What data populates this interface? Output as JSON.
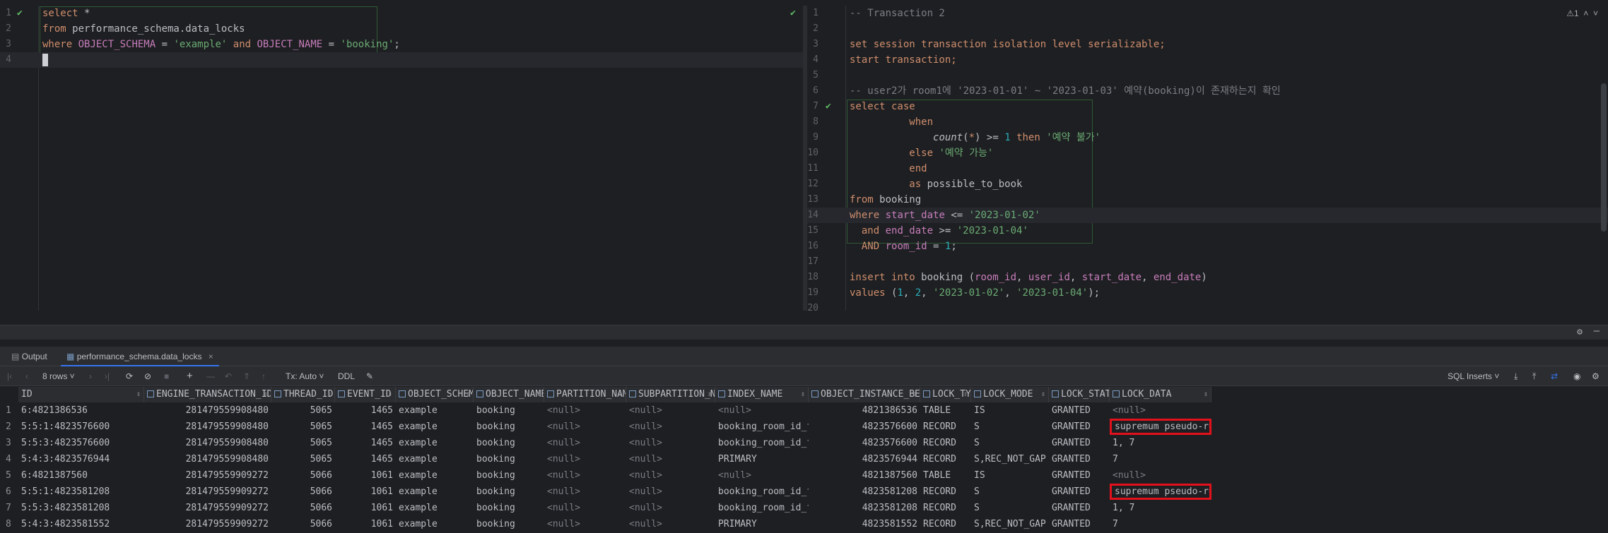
{
  "left_editor": {
    "lines": [
      {
        "n": "1",
        "html": "<span class=\"kw\">select</span> *"
      },
      {
        "n": "2",
        "html": "<span class=\"kw\">from</span> performance_schema.data_locks"
      },
      {
        "n": "3",
        "html": "<span class=\"kw\">where</span> <span class=\"fld\">OBJECT_SCHEMA</span> = <span class=\"str\">'example'</span> <span class=\"kw\">and</span> <span class=\"fld\">OBJECT_NAME</span> = <span class=\"str\">'booking'</span>;"
      },
      {
        "n": "4",
        "html": ""
      }
    ]
  },
  "right_editor": {
    "inspection": "⚠1",
    "lines": [
      {
        "n": "1",
        "html": "<span class=\"cmt\">-- Transaction 2</span>"
      },
      {
        "n": "2",
        "html": ""
      },
      {
        "n": "3",
        "html": "<span class=\"kw\">set session transaction isolation level serializable;</span>"
      },
      {
        "n": "4",
        "html": "<span class=\"kw\">start transaction;</span>"
      },
      {
        "n": "5",
        "html": ""
      },
      {
        "n": "6",
        "html": "<span class=\"cmt\">-- user2가 room1에 '2023-01-01' ~ '2023-01-03' 예약(booking)이 존재하는지 확인</span>"
      },
      {
        "n": "7",
        "html": "<span class=\"kw\">select case</span>"
      },
      {
        "n": "8",
        "html": "          <span class=\"kw\">when</span>"
      },
      {
        "n": "9",
        "html": "              <span class=\"fn\">count</span>(<span class=\"kw\">*</span>) >= <span class=\"num\">1</span> <span class=\"kw\">then</span> <span class=\"str\">'예약 불가'</span>"
      },
      {
        "n": "10",
        "html": "          <span class=\"kw\">else</span> <span class=\"str\">'예약 가능'</span>"
      },
      {
        "n": "11",
        "html": "          <span class=\"kw\">end</span>"
      },
      {
        "n": "12",
        "html": "          <span class=\"kw\">as</span> possible_to_book"
      },
      {
        "n": "13",
        "html": "<span class=\"kw\">from</span> booking"
      },
      {
        "n": "14",
        "html": "<span class=\"kw\">where</span> <span class=\"fld\">start_date</span> <= <span class=\"str\">'2023-01-02'</span>"
      },
      {
        "n": "15",
        "html": "  <span class=\"kw\">and</span> <span class=\"fld\">end_date</span> >= <span class=\"str\">'2023-01-04'</span>"
      },
      {
        "n": "16",
        "html": "  <span class=\"kw\">AND</span> <span class=\"fld\">room_id</span> = <span class=\"num\">1</span>;"
      },
      {
        "n": "17",
        "html": ""
      },
      {
        "n": "18",
        "html": "<span class=\"kw\">insert into</span> booking (<span class=\"fld\">room_id</span>, <span class=\"fld\">user_id</span>, <span class=\"fld\">start_date</span>, <span class=\"fld\">end_date</span>)"
      },
      {
        "n": "19",
        "html": "<span class=\"kw\">values</span> (<span class=\"num\">1</span>, <span class=\"num\">2</span>, <span class=\"str\">'2023-01-02'</span>, <span class=\"str\">'2023-01-04'</span>);"
      },
      {
        "n": "20",
        "html": ""
      }
    ]
  },
  "tabs": {
    "output": "Output",
    "result": "performance_schema.data_locks"
  },
  "toolbar": {
    "rows": "8 rows",
    "tx": "Tx: Auto",
    "ddl": "DDL",
    "export": "SQL Inserts"
  },
  "grid": {
    "columns": [
      "ID",
      "ENGINE_TRANSACTION_ID",
      "THREAD_ID",
      "EVENT_ID",
      "OBJECT_SCHEMA",
      "OBJECT_NAME",
      "PARTITION_NAME",
      "SUBPARTITION_NAME",
      "INDEX_NAME",
      "OBJECT_INSTANCE_BEGIN",
      "LOCK_TYPE",
      "LOCK_MODE",
      "LOCK_STATUS",
      "LOCK_DATA"
    ],
    "rows": [
      [
        "1",
        "6:4821386536",
        "281479559908480",
        "5065",
        "1465",
        "example",
        "booking",
        "<null>",
        "<null>",
        "<null>",
        "4821386536",
        "TABLE",
        "IS",
        "GRANTED",
        "<null>"
      ],
      [
        "2",
        "5:5:1:4823576600",
        "281479559908480",
        "5065",
        "1465",
        "example",
        "booking",
        "<null>",
        "<null>",
        "booking_room_id_fk",
        "4823576600",
        "RECORD",
        "S",
        "GRANTED",
        "supremum pseudo-record"
      ],
      [
        "3",
        "5:5:3:4823576600",
        "281479559908480",
        "5065",
        "1465",
        "example",
        "booking",
        "<null>",
        "<null>",
        "booking_room_id_fk",
        "4823576600",
        "RECORD",
        "S",
        "GRANTED",
        "1, 7"
      ],
      [
        "4",
        "5:4:3:4823576944",
        "281479559908480",
        "5065",
        "1465",
        "example",
        "booking",
        "<null>",
        "<null>",
        "PRIMARY",
        "4823576944",
        "RECORD",
        "S,REC_NOT_GAP",
        "GRANTED",
        "7"
      ],
      [
        "5",
        "6:4821387560",
        "281479559909272",
        "5066",
        "1061",
        "example",
        "booking",
        "<null>",
        "<null>",
        "<null>",
        "4821387560",
        "TABLE",
        "IS",
        "GRANTED",
        "<null>"
      ],
      [
        "6",
        "5:5:1:4823581208",
        "281479559909272",
        "5066",
        "1061",
        "example",
        "booking",
        "<null>",
        "<null>",
        "booking_room_id_fk",
        "4823581208",
        "RECORD",
        "S",
        "GRANTED",
        "supremum pseudo-record"
      ],
      [
        "7",
        "5:5:3:4823581208",
        "281479559909272",
        "5066",
        "1061",
        "example",
        "booking",
        "<null>",
        "<null>",
        "booking_room_id_fk",
        "4823581208",
        "RECORD",
        "S",
        "GRANTED",
        "1, 7"
      ],
      [
        "8",
        "5:4:3:4823581552",
        "281479559909272",
        "5066",
        "1061",
        "example",
        "booking",
        "<null>",
        "<null>",
        "PRIMARY",
        "4823581552",
        "RECORD",
        "S,REC_NOT_GAP",
        "GRANTED",
        "7"
      ]
    ],
    "highlighted_rows": [
      2,
      6
    ]
  }
}
